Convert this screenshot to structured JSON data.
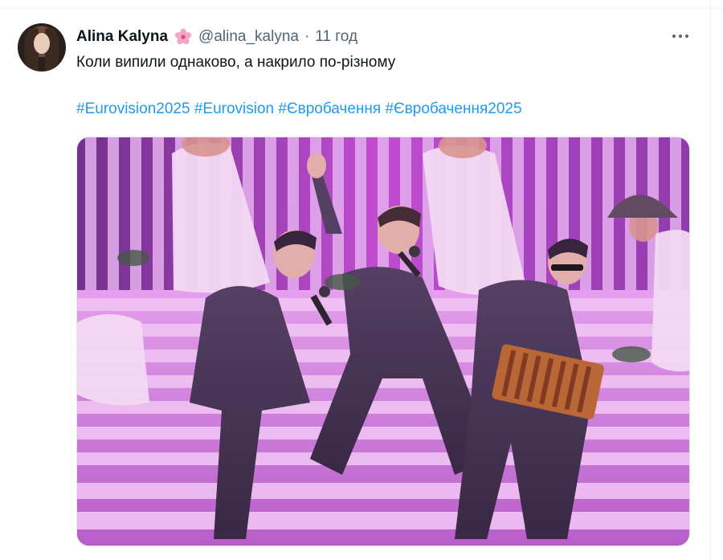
{
  "tweet": {
    "display_name": "Alina Kalyna",
    "handle": "@alina_kalyna",
    "separator": "·",
    "time": "11 год",
    "text": "Коли випили однаково, а накрило по-різному",
    "hashtags": [
      "#Eurovision2025",
      "#Eurovision",
      "#Євробачення",
      "#Євробачення2025"
    ]
  },
  "icons": {
    "name_badge": "cherry-blossom-icon",
    "more": "more-dots-icon"
  },
  "colors": {
    "text_primary": "#0f1419",
    "text_secondary": "#536471",
    "link": "#1d9bf0",
    "stage_light": "#c94fd6"
  }
}
